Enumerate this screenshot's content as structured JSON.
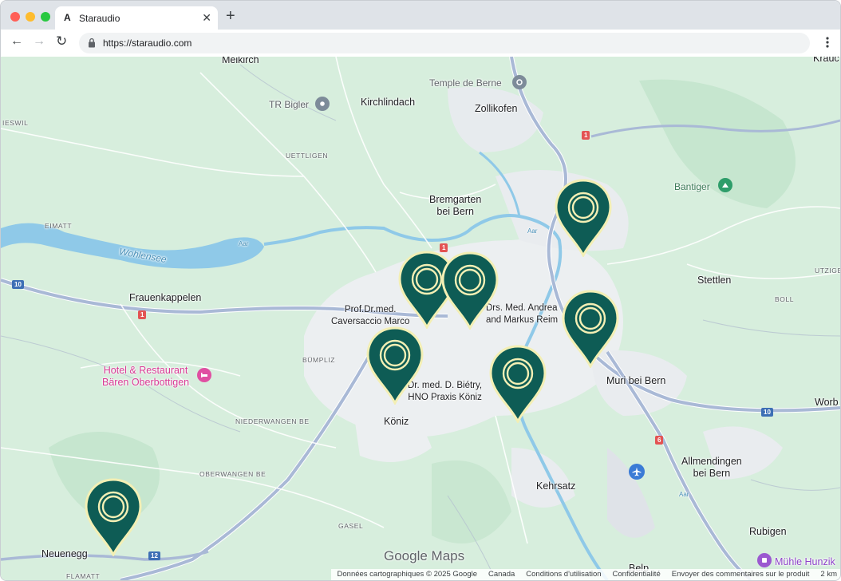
{
  "browser": {
    "tab_title": "Staraudio",
    "tab_favicon": "A",
    "url": "https://staraudio.com",
    "new_tab_symbol": "+",
    "close_symbol": "✕",
    "back_symbol": "←",
    "forward_symbol": "→",
    "reload_symbol": "↻"
  },
  "map": {
    "places": {
      "meikirch": "Meikirch",
      "temple": "Temple de Berne",
      "tr_bigler": "TR Bigler",
      "kirchlindach": "Kirchlindach",
      "zollikofen": "Zollikofen",
      "krauch": "Krauc",
      "ieswil": "IESWIL",
      "uettligen": "UETTLIGEN",
      "bremgarten": "Bremgarten\nbei Bern",
      "bantiger": "Bantiger",
      "eimatt": "EIMATT",
      "wohlensee": "Wohlensee",
      "aar1": "Aar",
      "aar2": "Aar",
      "aar3": "Aar",
      "stettlen": "Stettlen",
      "utzige": "UTZIGE",
      "frauenkappelen": "Frauenkappelen",
      "boll": "BOLL",
      "prof": "Prof.Dr.med.\nCaversaccio Marco",
      "drs_andrea": "Drs. Med. Andrea\nand Markus Reim",
      "bumpliz": "BÜMPLIZ",
      "hotel": "Hotel & Restaurant\nBären Oberbottigen",
      "biotry": "Dr. med. D. Biétry,\nHNO Praxis Köniz",
      "muri": "Muri bei Bern",
      "worb": "Worb",
      "koniz": "Köniz",
      "niederwangen": "NIEDERWANGEN BE",
      "allmendingen": "Allmendingen\nbei Bern",
      "oberwangen": "OBERWANGEN BE",
      "kehrsatz": "Kehrsatz",
      "gasel": "GASEL",
      "rubigen": "Rubigen",
      "neuenegg": "Neuenegg",
      "muhle": "Mühle Hunzik",
      "flamatt": "FLAMATT",
      "belp": "Belp"
    },
    "shields": {
      "r1a": "1",
      "r1b": "1",
      "r1c": "1",
      "r10a": "10",
      "r10b": "10",
      "r6": "6",
      "r12": "12"
    },
    "pin_icon": "map-pin-icon",
    "logo": "Google Maps",
    "attribution": {
      "data": "Données cartographiques © 2025 Google",
      "region": "Canada",
      "terms": "Conditions d'utilisation",
      "privacy": "Confidentialité",
      "feedback": "Envoyer des commentaires sur le produit",
      "scale": "2 km"
    },
    "colors": {
      "pin_fill": "#0e5c55",
      "pin_stroke": "#f3efb4",
      "land": "#d7eedd",
      "water": "#8fc9e8",
      "road": "#a9b9d6"
    }
  }
}
